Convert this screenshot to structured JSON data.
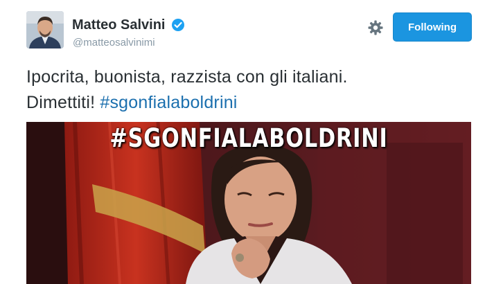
{
  "author": {
    "name": "Matteo Salvini",
    "handle": "@matteosalvinimi",
    "verified": true,
    "avatar_icon": "profile-photo"
  },
  "actions": {
    "settings_icon": "gear-icon",
    "follow_label": "Following"
  },
  "tweet": {
    "line1": "Ipocrita, buonista, razzista con gli italiani.",
    "line2_text": "Dimettiti! ",
    "hashtag": "#sgonfialaboldrini"
  },
  "media": {
    "caption": "#SGONFIALABOLDRINI"
  },
  "colors": {
    "follow_button": "#1b95e0",
    "link": "#1b6fae",
    "verified": "#1da1f2"
  }
}
